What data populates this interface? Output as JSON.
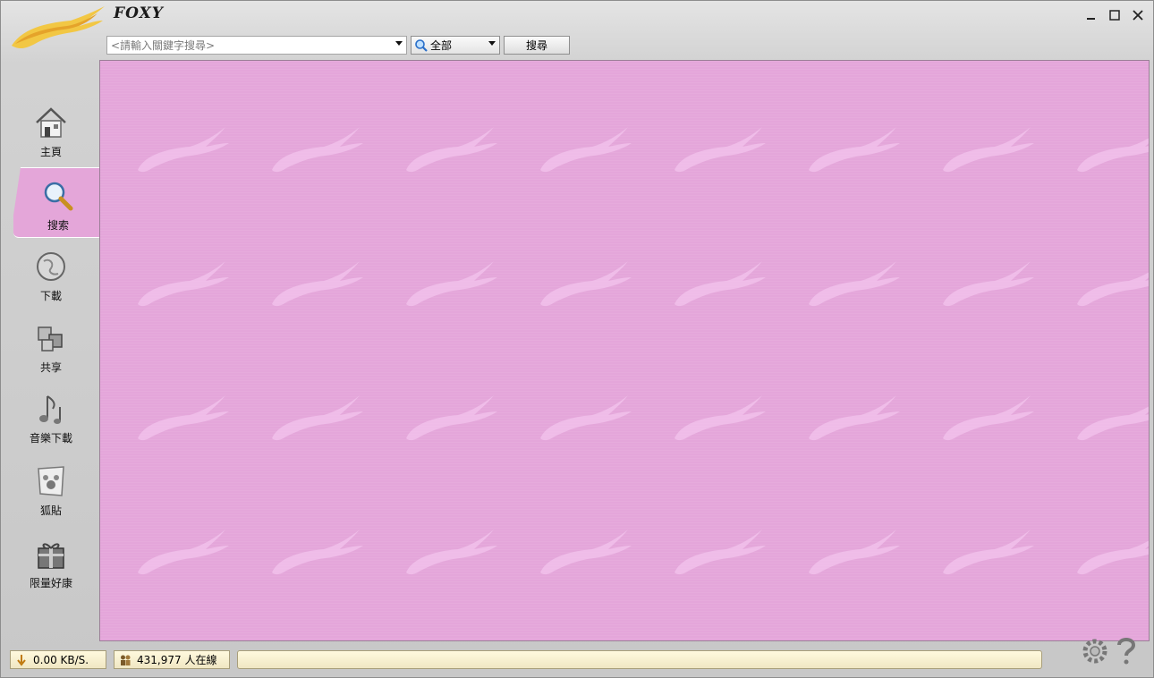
{
  "window": {
    "brand": "FOXY"
  },
  "search": {
    "placeholder": "<請輸入關鍵字搜尋>",
    "scope_value": "全部",
    "button_label": "搜尋"
  },
  "sidebar": {
    "items": [
      {
        "label": "主頁",
        "icon": "home-icon"
      },
      {
        "label": "搜索",
        "icon": "search-icon",
        "active": true
      },
      {
        "label": "下載",
        "icon": "globe-icon"
      },
      {
        "label": "共享",
        "icon": "share-boxes-icon"
      },
      {
        "label": "音樂下載",
        "icon": "music-note-icon"
      },
      {
        "label": "狐貼",
        "icon": "paw-note-icon"
      },
      {
        "label": "限量好康",
        "icon": "gift-icon"
      }
    ]
  },
  "status": {
    "speed": "0.00 KB/S.",
    "online": "431,977 人在線"
  },
  "colors": {
    "content_bg": "#e4a6da",
    "active_tab": "#e4a6d9",
    "status_bg": "#f4ecc9"
  }
}
